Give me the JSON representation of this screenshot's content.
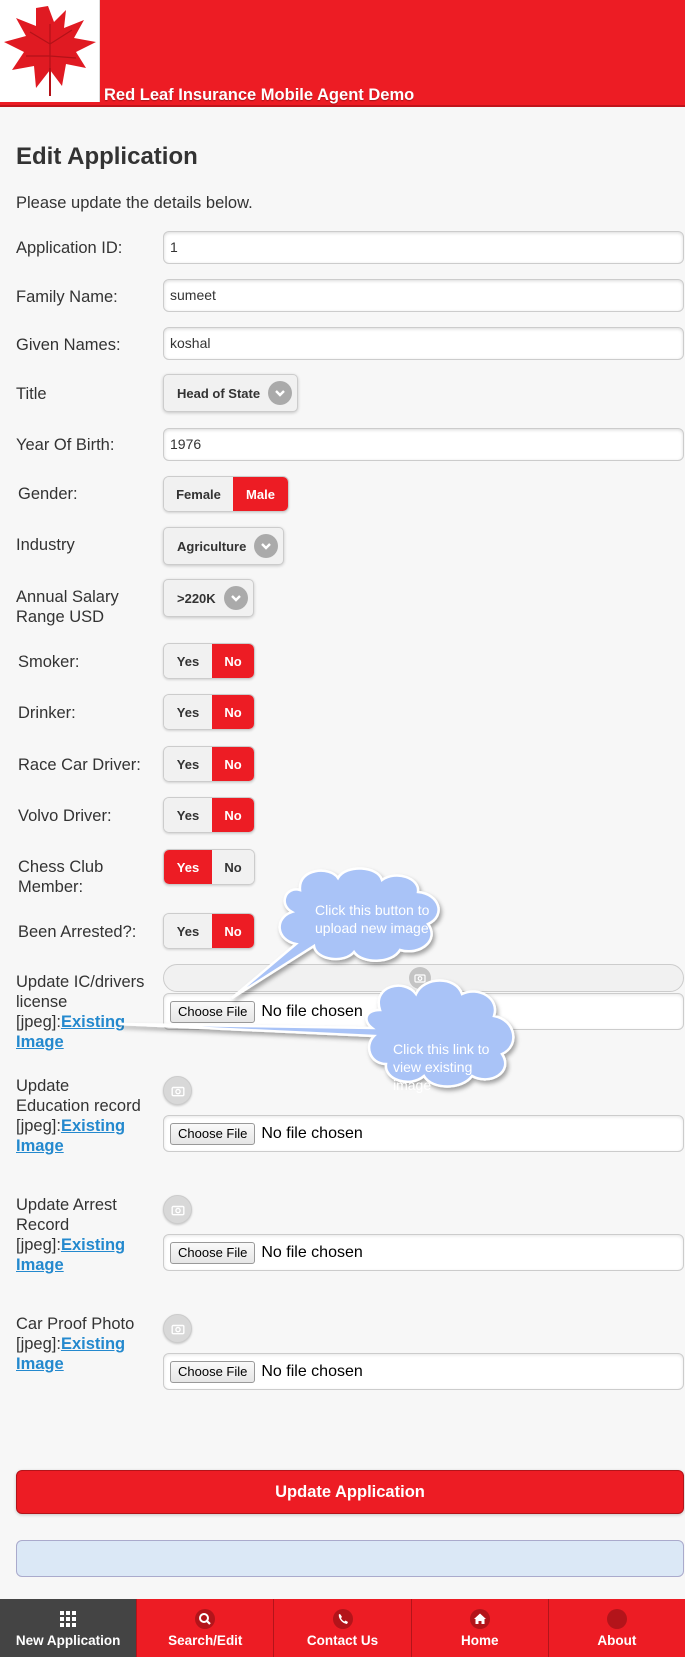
{
  "header": {
    "app_title": "Red Leaf Insurance Mobile Agent Demo"
  },
  "page": {
    "title": "Edit Application",
    "intro": "Please update the details below."
  },
  "form": {
    "application_id": {
      "label": "Application ID:",
      "value": "1"
    },
    "family_name": {
      "label": "Family Name:",
      "value": "sumeet"
    },
    "given_names": {
      "label": "Given Names:",
      "value": "koshal"
    },
    "title": {
      "label": "Title",
      "value": "Head of State"
    },
    "year_of_birth": {
      "label": "Year Of Birth:",
      "value": "1976"
    },
    "gender": {
      "label": "Gender:",
      "options": [
        "Female",
        "Male"
      ],
      "selected": "Male"
    },
    "industry": {
      "label": "Industry",
      "value": "Agriculture"
    },
    "salary": {
      "label": "Annual Salary Range USD",
      "value": ">220K"
    },
    "smoker": {
      "label": "Smoker:",
      "options": [
        "Yes",
        "No"
      ],
      "selected": "No"
    },
    "drinker": {
      "label": "Drinker:",
      "options": [
        "Yes",
        "No"
      ],
      "selected": "No"
    },
    "race_car_driver": {
      "label": "Race Car Driver:",
      "options": [
        "Yes",
        "No"
      ],
      "selected": "No"
    },
    "volvo_driver": {
      "label": "Volvo Driver:",
      "options": [
        "Yes",
        "No"
      ],
      "selected": "No"
    },
    "chess_club": {
      "label": "Chess Club Member:",
      "options": [
        "Yes",
        "No"
      ],
      "selected": "Yes"
    },
    "been_arrested": {
      "label": "Been Arrested?:",
      "options": [
        "Yes",
        "No"
      ],
      "selected": "No"
    }
  },
  "uploads": {
    "prefix": "[jpeg]:",
    "link_text": "Existing Image",
    "choose_label": "Choose File",
    "no_file_text": "No file chosen",
    "ic_license": {
      "label": "Update IC/drivers license"
    },
    "education": {
      "label": "Update Education record"
    },
    "arrest": {
      "label": "Update Arrest Record"
    },
    "car_proof": {
      "label": "Car Proof Photo"
    }
  },
  "callouts": {
    "upload": "Click this button to upload new image",
    "view": "Click this link to view existing image"
  },
  "actions": {
    "update_label": "Update Application"
  },
  "navbar": {
    "items": [
      {
        "label": "New Application",
        "icon": "grid-icon",
        "active": true
      },
      {
        "label": "Search/Edit",
        "icon": "search-icon",
        "active": false
      },
      {
        "label": "Contact Us",
        "icon": "phone-icon",
        "active": false
      },
      {
        "label": "Home",
        "icon": "home-icon",
        "active": false
      },
      {
        "label": "About",
        "icon": "about-icon",
        "active": false
      }
    ]
  },
  "colors": {
    "brand_red": "#ed1c24",
    "link_blue": "#2489ce",
    "callout_blue": "#a9c3f7"
  }
}
